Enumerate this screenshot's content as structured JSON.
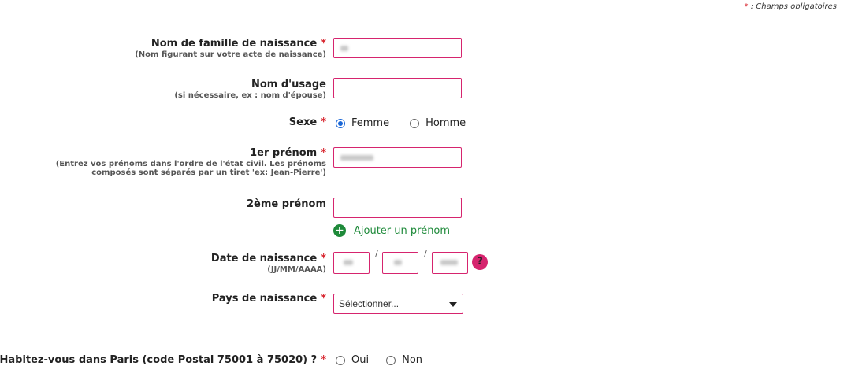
{
  "legend": {
    "star": "*",
    "text": " : Champs obligatoires"
  },
  "required_mark": "*",
  "nom_famille": {
    "label": "Nom de famille de naissance",
    "hint": "(Nom figurant sur votre acte de naissance)"
  },
  "nom_usage": {
    "label": "Nom d'usage",
    "hint": "(si nécessaire, ex : nom d'épouse)"
  },
  "sexe": {
    "label": "Sexe",
    "options": [
      "Femme",
      "Homme"
    ],
    "selected": "Femme"
  },
  "prenom1": {
    "label": "1er prénom",
    "hint_line1": "(Entrez vos prénoms dans l'ordre de l'état civil. Les prénoms",
    "hint_line2": "composés sont séparés par un tiret 'ex: Jean-Pierre')"
  },
  "prenom2": {
    "label": "2ème prénom"
  },
  "add_prenom": {
    "icon": "plus-circle-icon",
    "label": "Ajouter un prénom"
  },
  "date_naissance": {
    "label": "Date de naissance",
    "hint": "(JJ/MM/AAAA)",
    "separator": "/",
    "help": "?"
  },
  "pays": {
    "label": "Pays de naissance",
    "selected": "Sélectionner..."
  },
  "paris": {
    "label": "Habitez-vous dans Paris (code Postal 75001 à 75020) ?",
    "options": [
      "Oui",
      "Non"
    ]
  },
  "colors": {
    "required": "#d8262f",
    "field_border": "#d6246e",
    "radio_selected": "#1a66d6",
    "add_green": "#1e8a3a"
  }
}
